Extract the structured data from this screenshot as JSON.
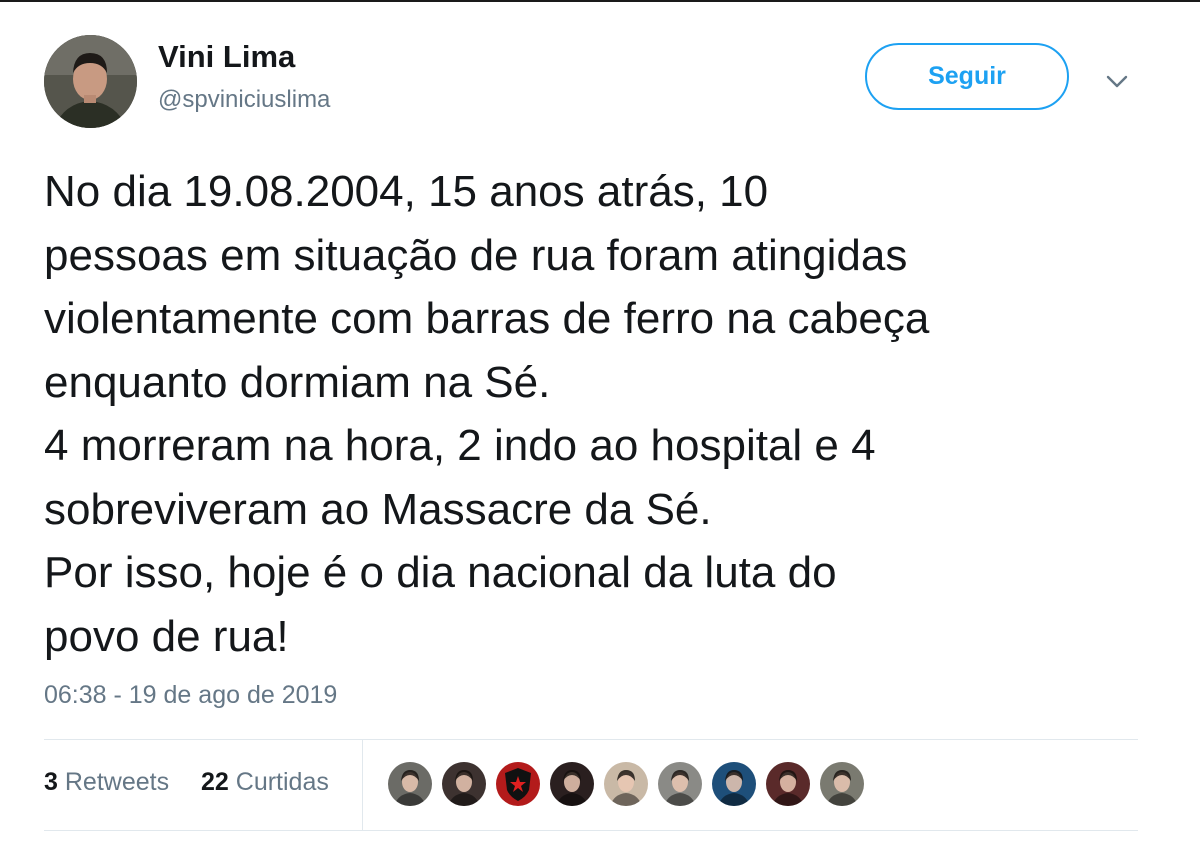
{
  "tweet": {
    "author": {
      "display_name": "Vini Lima",
      "handle": "@spviniciuslima",
      "avatar_icon": "profile-photo"
    },
    "follow_button_label": "Seguir",
    "menu_icon": "chevron-down-icon",
    "text_lines": [
      "No dia 19.08.2004, 15 anos atrás, 10",
      "pessoas em situação de rua foram atingidas",
      "violentamente com barras de ferro na cabeça",
      "enquanto dormiam na Sé.",
      "4 morreram na hora, 2 indo ao hospital e 4",
      "sobreviveram ao Massacre da Sé.",
      "Por isso, hoje é o dia nacional da luta do",
      "povo de rua!"
    ],
    "timestamp": "06:38 - 19 de ago de 2019",
    "stats": {
      "retweets_count": "3",
      "retweets_label": "Retweets",
      "likes_count": "22",
      "likes_label": "Curtidas"
    },
    "liker_avatars": [
      {
        "icon": "profile-photo",
        "color": "#6b6b66"
      },
      {
        "icon": "profile-photo",
        "color": "#3d3230"
      },
      {
        "icon": "shield-logo",
        "color": "#b31b1b"
      },
      {
        "icon": "profile-photo",
        "color": "#2a1f1f"
      },
      {
        "icon": "profile-photo",
        "color": "#c9b9a6"
      },
      {
        "icon": "profile-photo",
        "color": "#8a8a86"
      },
      {
        "icon": "profile-photo",
        "color": "#1e4f7a"
      },
      {
        "icon": "profile-photo",
        "color": "#5a2a2a"
      },
      {
        "icon": "profile-photo",
        "color": "#7a7a70"
      }
    ],
    "colors": {
      "accent": "#1da1f2",
      "text": "#14171a",
      "secondary_text": "#657786",
      "divider": "#e1e8ed"
    }
  }
}
